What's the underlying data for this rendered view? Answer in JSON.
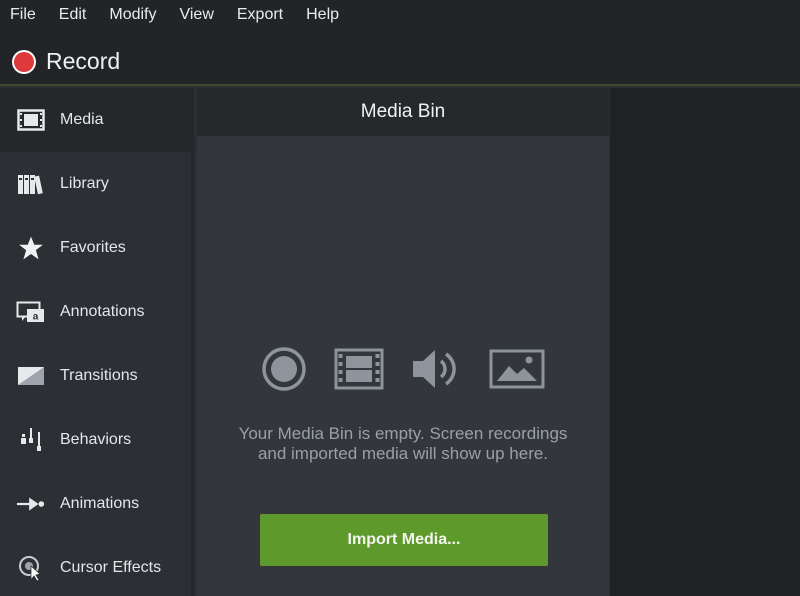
{
  "menu": [
    "File",
    "Edit",
    "Modify",
    "View",
    "Export",
    "Help"
  ],
  "record": {
    "label": "Record"
  },
  "sidebar": {
    "items": [
      {
        "label": "Media",
        "icon": "film-strip-icon",
        "active": true
      },
      {
        "label": "Library",
        "icon": "library-books-icon"
      },
      {
        "label": "Favorites",
        "icon": "star-icon"
      },
      {
        "label": "Annotations",
        "icon": "annotation-icon"
      },
      {
        "label": "Transitions",
        "icon": "transition-icon"
      },
      {
        "label": "Behaviors",
        "icon": "behaviors-icon"
      },
      {
        "label": "Animations",
        "icon": "animation-arrow-icon"
      },
      {
        "label": "Cursor Effects",
        "icon": "cursor-effects-icon"
      }
    ]
  },
  "media_bin": {
    "title": "Media Bin",
    "empty_message": "Your Media Bin is empty. Screen recordings and imported media will show up here.",
    "import_label": "Import Media...",
    "type_icons": [
      "recording-icon",
      "video-icon",
      "audio-icon",
      "image-icon"
    ]
  },
  "colors": {
    "accent_green": "#5e9a2b",
    "record_red": "#e0393b",
    "background": "#2b2e33"
  }
}
